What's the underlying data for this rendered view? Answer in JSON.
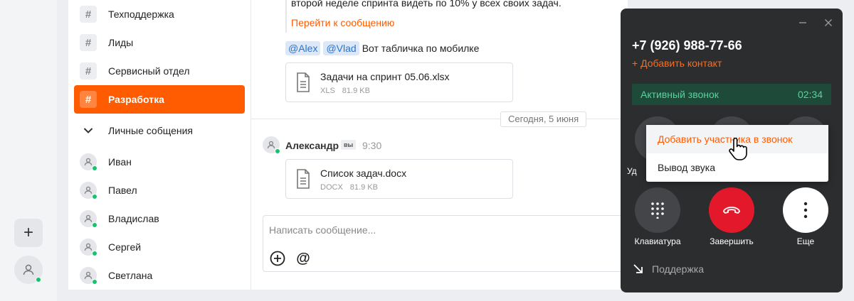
{
  "rail": {
    "add_label": "+",
    "icons": {
      "add": "plus-icon",
      "profile": "user-icon"
    }
  },
  "sidebar": {
    "channels": [
      {
        "label": "Техподдержка",
        "active": false
      },
      {
        "label": "Лиды",
        "active": false
      },
      {
        "label": "Сервисный отдел",
        "active": false
      },
      {
        "label": "Разработка",
        "active": true
      }
    ],
    "hash_symbol": "#",
    "private_section": "Личные собщения",
    "people": [
      "Иван",
      "Павел",
      "Владислав",
      "Сергей",
      "Светлана"
    ]
  },
  "chat": {
    "quoted_text": "второй неделе спринта видеть по 10% у всех своих задач.",
    "goto_link": "Перейти к сообщению",
    "mentions": [
      "@Alex",
      "@Vlad"
    ],
    "mention_text": "Вот табличка по мобилке",
    "file1": {
      "name": "Задачи на спринт 05.06.xlsx",
      "ext": "XLS",
      "size": "81.9 KB"
    },
    "date_divider": "Сегодня, 5 июня",
    "author": "Александр",
    "you_badge": "вы",
    "time": "9:30",
    "file2": {
      "name": "Список задач.docx",
      "ext": "DOCX",
      "size": "81.9 KB"
    },
    "composer_placeholder": "Написать сообщение...",
    "at_symbol": "@"
  },
  "call": {
    "phone": "+7 (926) 988-77-66",
    "add_contact": "+ Добавить контакт",
    "status": "Активный звонок",
    "duration": "02:34",
    "partial_label": "Уд",
    "keypad_label": "Клавиатура",
    "hangup_label": "Завершить",
    "more_label": "Еще",
    "support": "Поддержка",
    "colors": {
      "accent": "#ff5b00",
      "hangup": "#e3192b",
      "active_bg": "#1e4a3a",
      "active_text": "#57d39c"
    }
  },
  "menu": {
    "items": [
      "Добавить участника в звонок",
      "Вывод звука"
    ]
  }
}
